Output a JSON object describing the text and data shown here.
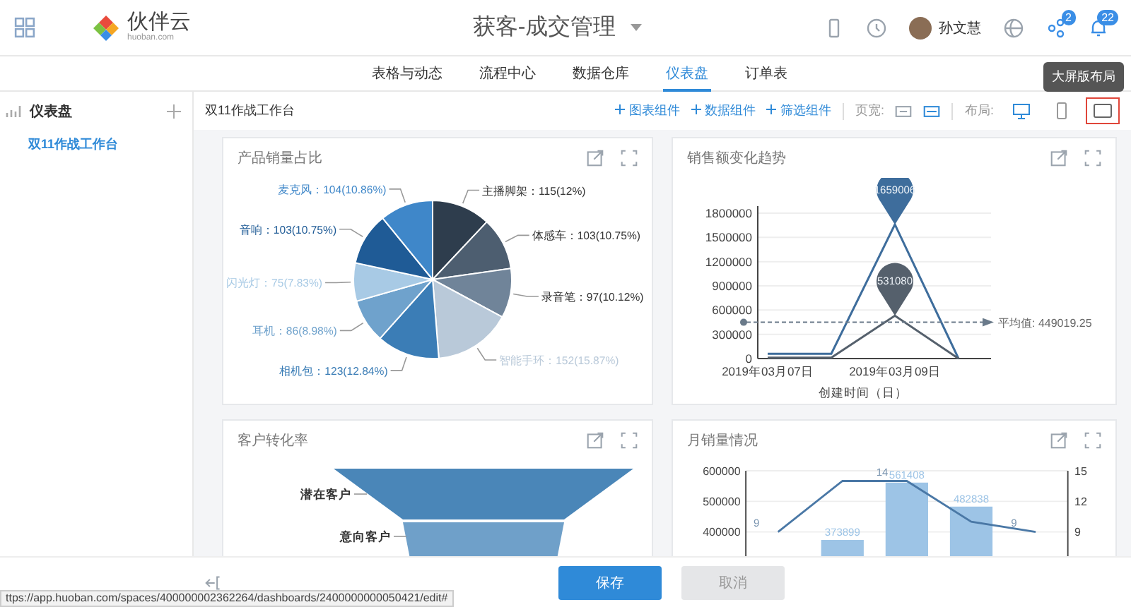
{
  "header": {
    "app_name": "伙伴云",
    "domain": "huoban.com",
    "title": "获客-成交管理",
    "user": "孙文慧",
    "badges": [
      "2",
      "22"
    ]
  },
  "tabs": [
    {
      "label": "表格与动态",
      "selected": false
    },
    {
      "label": "流程中心",
      "selected": false
    },
    {
      "label": "数据仓库",
      "selected": false
    },
    {
      "label": "仪表盘",
      "selected": true
    },
    {
      "label": "订单表",
      "selected": false
    }
  ],
  "sidebar": {
    "title": "仪表盘",
    "items": [
      {
        "label": "双11作战工作台",
        "selected": true
      }
    ]
  },
  "toolbar": {
    "title": "双11作战工作台",
    "actions": [
      "图表组件",
      "数据组件",
      "筛选组件"
    ],
    "page_width_label": "页宽:",
    "layout_label": "布局:",
    "layouts": [
      {
        "kind": "desktop",
        "selected": false
      },
      {
        "kind": "mobile",
        "selected": false
      },
      {
        "kind": "screen",
        "selected": true
      }
    ],
    "tooltip": "大屏版布局"
  },
  "cards": [
    {
      "kind": "chart",
      "title": "产品销量占比",
      "chart_data": {
        "type": "pie",
        "categories": [
          "主播脚架",
          "体感车",
          "录音笔",
          "智能手环",
          "相机包",
          "耳机",
          "闪光灯",
          "音响",
          "麦克风"
        ],
        "values": [
          115,
          103,
          97,
          152,
          123,
          86,
          75,
          103,
          104
        ],
        "data_labels": true,
        "value_labels": [
          "：115(12%)",
          "：103(10.75%)",
          "：97(10.12%)",
          "：152(15.87%)",
          "：123(12.84%)",
          "：86(8.98%)",
          "：75(7.83%)",
          "：103(10.75%)",
          "：104(10.86%)"
        ],
        "colors": [
          "#2e3d4d",
          "#4d5e70",
          "#708499",
          "#b9c9d9",
          "#3b7db6",
          "#6fa2cc",
          "#a8cae5",
          "#1f5b96",
          "#3f87c9"
        ]
      }
    },
    {
      "kind": "chart",
      "title": "销售额变化趋势",
      "chart_data": {
        "type": "line",
        "xlabel": "创建时间（日）",
        "categories": [
          "2019年03月07日",
          null,
          "2019年03月09日",
          null
        ],
        "ylim": [
          0,
          1800000
        ],
        "yticks": [
          0,
          300000,
          600000,
          900000,
          1200000,
          1500000,
          1800000
        ],
        "series": [
          {
            "color": "#3e6d9c",
            "values": [
              60000,
              60000,
              1660000,
              0
            ]
          },
          {
            "color": "#55606c",
            "values": [
              10000,
              10000,
              530000,
              0
            ]
          }
        ],
        "grid": true,
        "annotations": [
          {
            "text": "1659006",
            "x": "2019年03月09日",
            "y": 1659006
          },
          {
            "text": "531080",
            "x": "2019年03月09日",
            "y": 531080
          }
        ],
        "ref_lines": [
          {
            "axis": "y",
            "value": 449019.25,
            "label": "平均值: 449019.25"
          }
        ]
      }
    },
    {
      "kind": "funnel",
      "title": "客户转化率",
      "stages": [
        {
          "label": "潜在客户"
        },
        {
          "label": "意向客户"
        }
      ]
    },
    {
      "kind": "chart",
      "title": "月销量情况",
      "chart_data": {
        "type": "bar",
        "ylim": [
          300000,
          600000
        ],
        "yticks": [
          400000,
          500000,
          600000
        ],
        "y2lim": [
          6,
          15
        ],
        "y2ticks": [
          9,
          12,
          15
        ],
        "series": [
          {
            "type": "bar",
            "color": "#9dc4e6",
            "values": [
              null,
              373899,
              561408,
              482838,
              null
            ],
            "value_labels": [
              null,
              "373899",
              "561408",
              "482838",
              null
            ]
          },
          {
            "type": "line",
            "axis": "y2",
            "color": "#4a78a6",
            "values": [
              9,
              14,
              14,
              10,
              9
            ],
            "value_labels": [
              "9",
              null,
              "14",
              null,
              "9"
            ]
          }
        ]
      }
    }
  ],
  "footer": {
    "save": "保存",
    "cancel": "取消",
    "status_url": "ttps://app.huoban.com/spaces/400000002362264/dashboards/2400000000050421/edit#"
  }
}
